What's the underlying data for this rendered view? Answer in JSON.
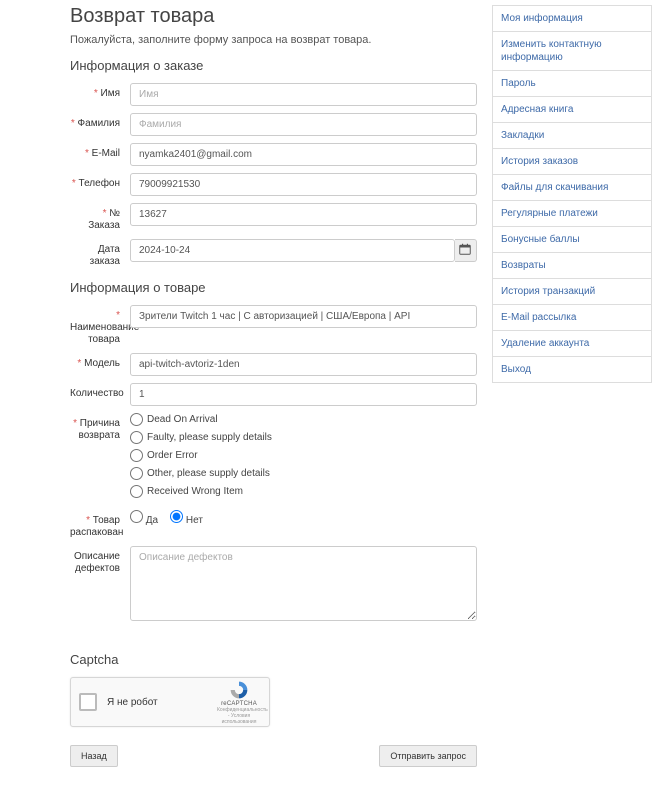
{
  "header": {
    "title": "Возврат товара",
    "intro": "Пожалуйста, заполните форму запроса на возврат товара."
  },
  "sections": {
    "order_info": "Информация о заказе",
    "product_info": "Информация о товаре",
    "captcha": "Captcha"
  },
  "fields": {
    "firstname": {
      "label": "Имя",
      "placeholder": "Имя"
    },
    "lastname": {
      "label": "Фамилия",
      "placeholder": "Фамилия"
    },
    "email": {
      "label": "E-Mail",
      "value": "nyamka2401@gmail.com"
    },
    "phone": {
      "label": "Телефон",
      "value": "79009921530"
    },
    "order_id": {
      "label": "№ Заказа",
      "value": "13627"
    },
    "date": {
      "label": "Дата заказа",
      "value": "2024-10-24"
    },
    "product": {
      "label": "Наименование товара",
      "value": "Зрители Twitch 1 час | С авторизацией | США/Европа | API"
    },
    "model": {
      "label": "Модель",
      "value": "api-twitch-avtoriz-1den"
    },
    "qty": {
      "label": "Количество",
      "value": "1"
    },
    "reason": {
      "label": "Причина возврата",
      "options": [
        "Dead On Arrival",
        "Faulty, please supply details",
        "Order Error",
        "Other, please supply details",
        "Received Wrong Item"
      ]
    },
    "opened": {
      "label": "Товар распакован",
      "yes": "Да",
      "no": "Нет"
    },
    "comment": {
      "label": "Описание дефектов",
      "placeholder": "Описание дефектов"
    }
  },
  "captcha": {
    "label": "Я не робот",
    "brand": "reCAPTCHA",
    "terms": "Конфиденциальность - Условия использования"
  },
  "buttons": {
    "back": "Назад",
    "submit": "Отправить запрос"
  },
  "sidebar": [
    "Моя информация",
    "Изменить контактную информацию",
    "Пароль",
    "Адресная книга",
    "Закладки",
    "История заказов",
    "Файлы для скачивания",
    "Регулярные платежи",
    "Бонусные баллы",
    "Возвраты",
    "История транзакций",
    "E-Mail рассылка",
    "Удаление аккаунта",
    "Выход"
  ]
}
